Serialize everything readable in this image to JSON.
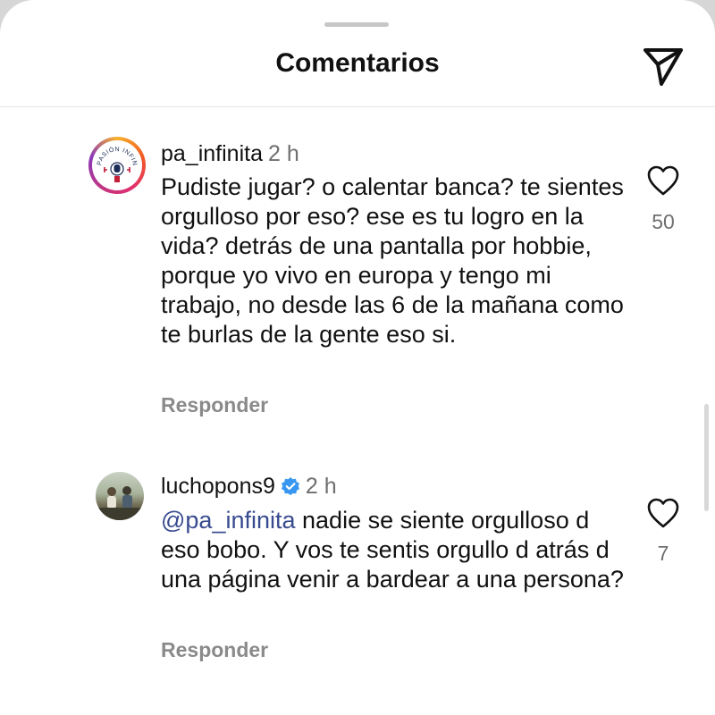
{
  "header": {
    "title": "Comentarios",
    "share_icon": "paper-plane-icon"
  },
  "comments": [
    {
      "username": "pa_infinita",
      "time": "2 h",
      "text": "Pudiste jugar? o calentar banca? te sientes orgulloso por eso? ese es tu logro en la vida? detrás de una pantalla por hobbie, porque yo vivo en europa y tengo mi trabajo, no desde las 6 de la mañana como te burlas de la gente eso si.",
      "reply_label": "Responder",
      "likes": "50",
      "avatar_logo_text": "PASIÓN INFINITA"
    },
    {
      "username": "luchopons9",
      "verified": true,
      "time": "2 h",
      "mention": "@pa_infinita",
      "text": " nadie se siente orgulloso d eso bobo. Y vos te sentis orgullo d atrás d una página venir a bardear a una persona?",
      "reply_label": "Responder",
      "likes": "7"
    }
  ],
  "colors": {
    "mention": "#384b8f",
    "verified": "#3897f0",
    "muted": "#8a8a8a"
  }
}
